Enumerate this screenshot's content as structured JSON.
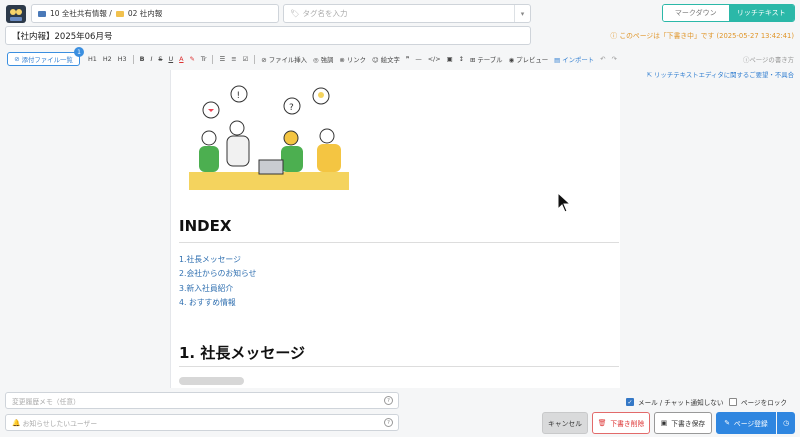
{
  "header": {
    "breadcrumb_part1": "10 全社共有情報 /",
    "breadcrumb_part2": "02 社内報",
    "tag_placeholder": "タグ名を入力",
    "mode_markdown": "マークダウン",
    "mode_richtext": "リッチテキスト",
    "title_value": "【社内報】2025年06月号",
    "draft_notice": "このページは「下書き中」です (2025-05-27 13:42:41)"
  },
  "toolbar": {
    "attach_label": "添付ファイル一覧",
    "attach_count": "1",
    "h1": "H1",
    "h2": "H2",
    "h3": "H3",
    "bold": "B",
    "italic": "I",
    "strike": "S",
    "underline": "U",
    "color": "A",
    "clear": "Tr",
    "file_insert": "ファイル挿入",
    "emphasis": "強調",
    "link": "リンク",
    "emoji": "絵文字",
    "quote": "❞",
    "hr": "—",
    "code": "</>",
    "table": "テーブル",
    "preview": "プレビュー",
    "import": "インポート",
    "history_link": "ページの書き方",
    "feedback_link": "リッチテキストエディタに関するご要望・不具合"
  },
  "editor": {
    "index_heading": "INDEX",
    "toc": [
      "1.社長メッセージ",
      "2.会社からのお知らせ",
      "3.新入社員紹介",
      "4. おすすめ情報"
    ],
    "section_heading": "1. 社長メッセージ"
  },
  "footer": {
    "memo_placeholder": "変更履歴メモ（任意）",
    "notify_placeholder": "お知らせしたいユーザー",
    "mail_notify_label": "メール / チャット通知しない",
    "lock_label": "ページをロック",
    "cancel_label": "キャンセル",
    "delete_draft_label": "下書き削除",
    "save_draft_label": "下書き保存",
    "register_label": "ページ登録"
  },
  "colors": {
    "accent": "#2bb8a8",
    "primary": "#2f86e0",
    "warning": "#e0962a",
    "danger": "#d33333"
  }
}
